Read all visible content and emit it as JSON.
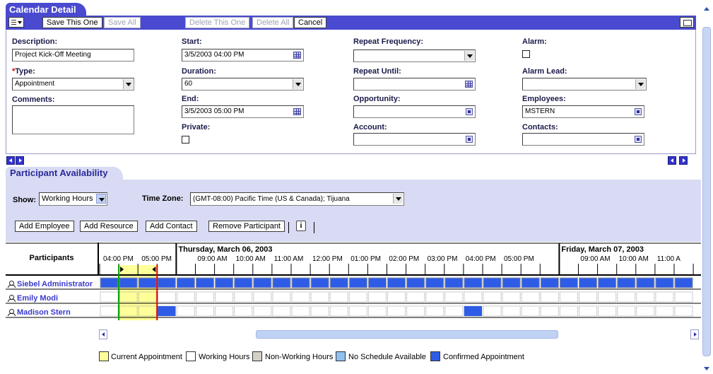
{
  "calendar_detail": {
    "tab_title": "Calendar Detail",
    "toolbar": {
      "save_this_one": "Save This One",
      "save_all": "Save All",
      "delete_this_one": "Delete This One",
      "delete_all": "Delete All",
      "cancel": "Cancel"
    },
    "fields": {
      "description": {
        "label": "Description:",
        "value": "Project Kick-Off Meeting"
      },
      "type": {
        "label": "Type:",
        "required_mark": "*",
        "value": "Appointment"
      },
      "comments": {
        "label": "Comments:",
        "value": ""
      },
      "start": {
        "label": "Start:",
        "value": "3/5/2003 04:00 PM"
      },
      "duration": {
        "label": "Duration:",
        "value": "60"
      },
      "end": {
        "label": "End:",
        "value": "3/5/2003 05:00 PM"
      },
      "private": {
        "label": "Private:",
        "checked": false
      },
      "repeat_frequency": {
        "label": "Repeat Frequency:",
        "value": ""
      },
      "repeat_until": {
        "label": "Repeat Until:",
        "value": ""
      },
      "opportunity": {
        "label": "Opportunity:",
        "value": ""
      },
      "account": {
        "label": "Account:",
        "value": ""
      },
      "alarm": {
        "label": "Alarm:",
        "checked": false
      },
      "alarm_lead": {
        "label": "Alarm Lead:",
        "value": ""
      },
      "employees": {
        "label": "Employees:",
        "value": "MSTERN"
      },
      "contacts": {
        "label": "Contacts:",
        "value": ""
      }
    }
  },
  "participant_availability": {
    "tab_title": "Participant Availability",
    "show": {
      "label": "Show:",
      "value": "Working Hours"
    },
    "time_zone": {
      "label": "Time Zone:",
      "value": "(GMT-08:00) Pacific Time (US & Canada); Tijuana"
    },
    "buttons": {
      "add_employee": "Add Employee",
      "add_resource": "Add Resource",
      "add_contact": "Add Contact",
      "remove_participant": "Remove Participant"
    },
    "info_icon_glyph": "i",
    "grid": {
      "participants_header": "Participants",
      "first_day_times": [
        "04:00 PM",
        "05:00 PM"
      ],
      "days": [
        {
          "title": "Thursday, March 06, 2003",
          "times": [
            "09:00 AM",
            "10:00 AM",
            "11:00 AM",
            "12:00 PM",
            "01:00 PM",
            "02:00 PM",
            "03:00 PM",
            "04:00 PM",
            "05:00 PM"
          ]
        },
        {
          "title": "Friday, March 07, 2003",
          "times": [
            "09:00 AM",
            "10:00 AM",
            "11:00 A"
          ]
        }
      ],
      "participants": [
        {
          "name": "Siebel Administrator",
          "busy_all": true
        },
        {
          "name": "Emily Modi",
          "busy_all": false
        },
        {
          "name": "Madison Stern",
          "busy_all": false
        }
      ]
    },
    "legend": [
      {
        "label": "Current Appointment",
        "color": "#ffff99"
      },
      {
        "label": "Working Hours",
        "color": "#ffffff"
      },
      {
        "label": "Non-Working Hours",
        "color": "#d4d0c8"
      },
      {
        "label": "No Schedule Available",
        "color": "#8ec0f0"
      },
      {
        "label": "Confirmed Appointment",
        "color": "#2e5ce6"
      }
    ]
  },
  "colors": {
    "section_header": "#4a4ad0",
    "panel_bg": "#d8dbf3",
    "current_appointment": "#ffff99",
    "confirmed_appointment": "#2e5ce6",
    "participant_link": "#3a3acc"
  }
}
